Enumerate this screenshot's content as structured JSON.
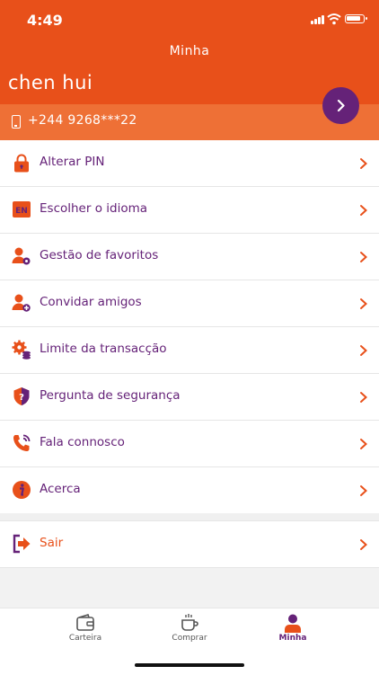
{
  "status": {
    "time": "4:49"
  },
  "header": {
    "title": "Minha",
    "username": "chen hui",
    "phone": "+244 9268***22"
  },
  "menu": [
    {
      "label": "Alterar PIN",
      "icon": "lock-icon"
    },
    {
      "label": "Escolher o idioma",
      "icon": "language-en-icon",
      "icon_text": "EN"
    },
    {
      "label": "Gestão de favoritos",
      "icon": "user-settings-icon"
    },
    {
      "label": "Convidar amigos",
      "icon": "user-add-icon"
    },
    {
      "label": "Limite da transacção",
      "icon": "gear-coins-icon"
    },
    {
      "label": "Pergunta de segurança",
      "icon": "shield-question-icon"
    },
    {
      "label": "Fala connosco",
      "icon": "phone-call-icon"
    },
    {
      "label": "Acerca",
      "icon": "info-icon"
    }
  ],
  "logout": {
    "label": "Sair",
    "icon": "logout-icon"
  },
  "tabs": [
    {
      "label": "Carteira",
      "icon": "wallet-icon",
      "active": false
    },
    {
      "label": "Comprar",
      "icon": "cup-icon",
      "active": false
    },
    {
      "label": "Minha",
      "icon": "person-icon",
      "active": true
    }
  ],
  "colors": {
    "orange": "#e8501a",
    "orange_light": "#ee7036",
    "purple": "#652278"
  }
}
